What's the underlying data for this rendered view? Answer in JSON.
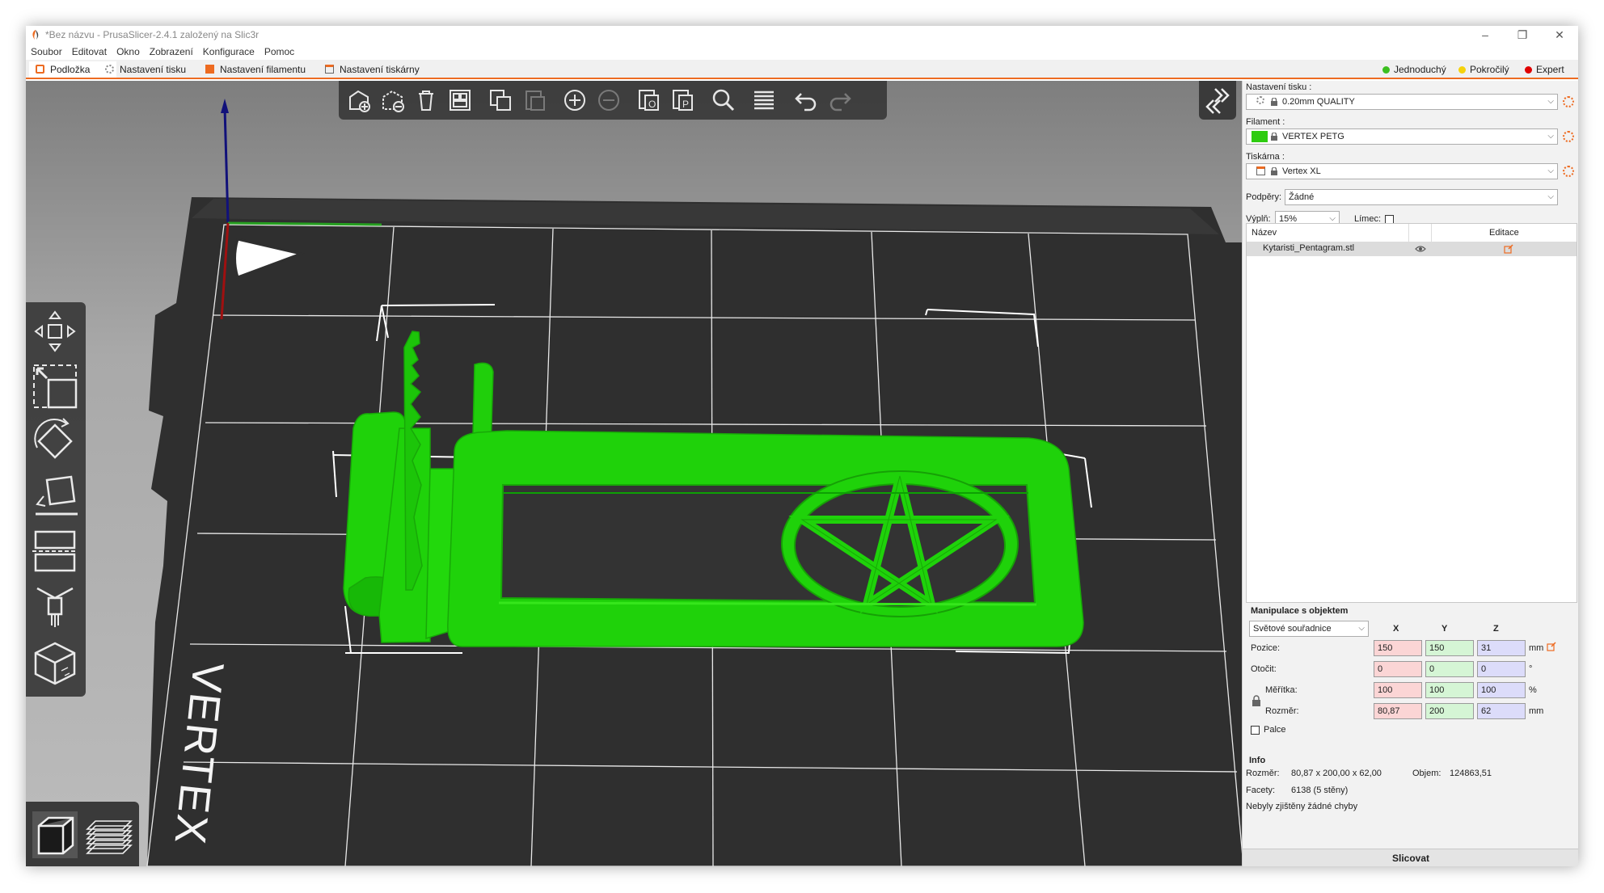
{
  "window": {
    "title": "*Bez názvu - PrusaSlicer-2.4.1 založený na Slic3r",
    "controls": [
      "–",
      "❐",
      "✕"
    ]
  },
  "menu": [
    "Soubor",
    "Editovat",
    "Okno",
    "Zobrazení",
    "Konfigurace",
    "Pomoc"
  ],
  "tabs": [
    {
      "label": "Podložka",
      "icon": "bed-icon",
      "active": true
    },
    {
      "label": "Nastavení tisku",
      "icon": "gear-icon"
    },
    {
      "label": "Nastavení filamentu",
      "icon": "spool-icon"
    },
    {
      "label": "Nastavení tiskárny",
      "icon": "printer-icon"
    }
  ],
  "modes": [
    {
      "label": "Jednoduchý",
      "color": "#3bbf1f"
    },
    {
      "label": "Pokročilý",
      "color": "#f5d20a"
    },
    {
      "label": "Expert",
      "color": "#e00000"
    }
  ],
  "toolbar": [
    "add-icon",
    "delete-icon",
    "delete-all-icon",
    "arrange-icon",
    "copy-icon",
    "paste-icon",
    "add-instance-icon",
    "remove-instance-icon",
    "split-objects-icon",
    "split-parts-icon",
    "search-icon",
    "layers-icon",
    "undo-icon",
    "redo-icon"
  ],
  "gizmos": [
    "move-icon",
    "scale-icon",
    "rotate-icon",
    "place-on-face-icon",
    "cut-icon",
    "paint-supports-icon",
    "seam-painting-icon"
  ],
  "bed": {
    "logo_text": "VERTEX"
  },
  "model": {
    "color": "#1fd20a"
  },
  "sidebar": {
    "print_settings_label": "Nastavení tisku :",
    "print_settings_value": "0.20mm QUALITY",
    "filament_label": "Filament :",
    "filament_value": "VERTEX PETG",
    "filament_color": "#2ecc10",
    "printer_label": "Tiskárna :",
    "printer_value": "Vertex XL",
    "supports_label": "Podpěry:",
    "supports_value": "Žádné",
    "infill_label": "Výplň:",
    "infill_value": "15%",
    "brim_label": "Límec:",
    "brim_checked": false
  },
  "objects": {
    "col_name": "Název",
    "col_edit": "Editace",
    "rows": [
      {
        "name": "Kytaristi_Pentagram.stl"
      }
    ]
  },
  "manipulation": {
    "title": "Manipulace s objektem",
    "coord_select": "Světové souřadnice",
    "axis_x": "X",
    "axis_y": "Y",
    "axis_z": "Z",
    "position_label": "Pozice:",
    "position": [
      "150",
      "150",
      "31"
    ],
    "position_unit": "mm",
    "rotate_label": "Otočit:",
    "rotate": [
      "0",
      "0",
      "0"
    ],
    "rotate_unit": "°",
    "scale_label": "Měřítka:",
    "scale": [
      "100",
      "100",
      "100"
    ],
    "scale_unit": "%",
    "size_label": "Rozměr:",
    "size": [
      "80,87",
      "200",
      "62"
    ],
    "size_unit": "mm",
    "inches_label": "Palce",
    "inches_checked": false
  },
  "info": {
    "title": "Info",
    "size_label": "Rozměr:",
    "size_value": "80,87 x 200,00 x 62,00",
    "volume_label": "Objem:",
    "volume_value": "124863,51",
    "facets_label": "Facety:",
    "facets_value": "6138 (5 stěny)",
    "errors_text": "Nebyly zjištěny žádné chyby"
  },
  "slice_button": "Slicovat"
}
